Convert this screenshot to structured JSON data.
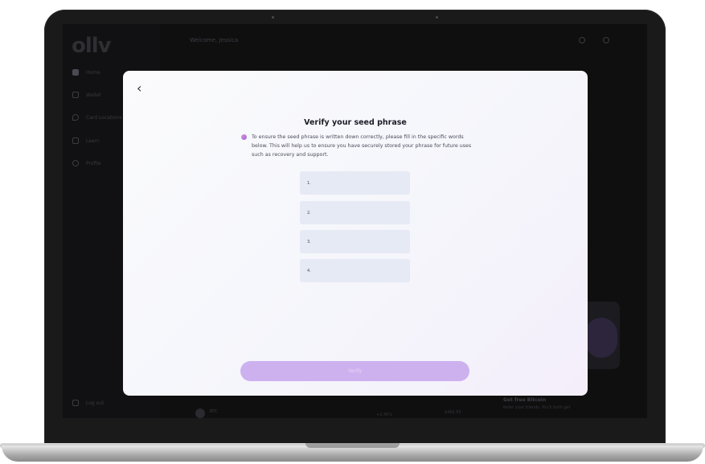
{
  "app": {
    "logo": "ollv",
    "welcome": "Welcome, Jessica"
  },
  "sidebar": {
    "items": [
      {
        "label": "Home",
        "icon": "grid-icon"
      },
      {
        "label": "Wallet",
        "icon": "wallet-icon"
      },
      {
        "label": "Card Locations",
        "icon": "location-pin-icon"
      },
      {
        "label": "Learn",
        "icon": "book-icon"
      },
      {
        "label": "Profile",
        "icon": "user-icon"
      }
    ],
    "logout": "Log out"
  },
  "background": {
    "promo_title": "Get free Bitcoin",
    "promo_text": "Refer your friends. You'll both get",
    "row_symbol": "BTC",
    "row_value": "$482.55",
    "row_change": "+2.45%"
  },
  "modal": {
    "title": "Verify your seed phrase",
    "info": "To ensure the seed phrase is written down correctly, please fill in the specific words below. This will help us to ensure you have securely stored your phrase for future uses such as recovery and support.",
    "fields": [
      {
        "label": "1.",
        "value": ""
      },
      {
        "label": "2.",
        "value": ""
      },
      {
        "label": "3.",
        "value": ""
      },
      {
        "label": "4.",
        "value": ""
      }
    ],
    "verify_label": "Verify"
  },
  "colors": {
    "accent": "#cdb1ef",
    "field_bg": "#e6eaf4",
    "modal_bg": "#f8f9fc"
  }
}
